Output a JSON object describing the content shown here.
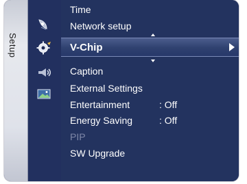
{
  "sidebar": {
    "label": "Setup"
  },
  "menu": {
    "items": [
      {
        "label": "Time",
        "value": "",
        "state": "normal"
      },
      {
        "label": "Network setup",
        "value": "",
        "state": "normal"
      },
      {
        "label": "V-Chip",
        "value": "",
        "state": "selected"
      },
      {
        "label": "Caption",
        "value": "",
        "state": "normal"
      },
      {
        "label": "External Settings",
        "value": "",
        "state": "normal"
      },
      {
        "label": "Entertainment",
        "value": ": Off",
        "state": "normal"
      },
      {
        "label": "Energy Saving",
        "value": ": Off",
        "state": "normal"
      },
      {
        "label": "PIP",
        "value": "",
        "state": "disabled"
      },
      {
        "label": "SW Upgrade",
        "value": "",
        "state": "normal"
      }
    ]
  },
  "icons": {
    "category_icons": [
      "satellite-dish-icon",
      "gear-setup-icon",
      "sound-wave-icon",
      "picture-icon"
    ]
  },
  "colors": {
    "panel_bg": "#23335f",
    "highlight": "#2f416f",
    "text": "#ffffff",
    "disabled_text": "#7f88a8",
    "sidebar_bg": "#e7e9ee"
  }
}
